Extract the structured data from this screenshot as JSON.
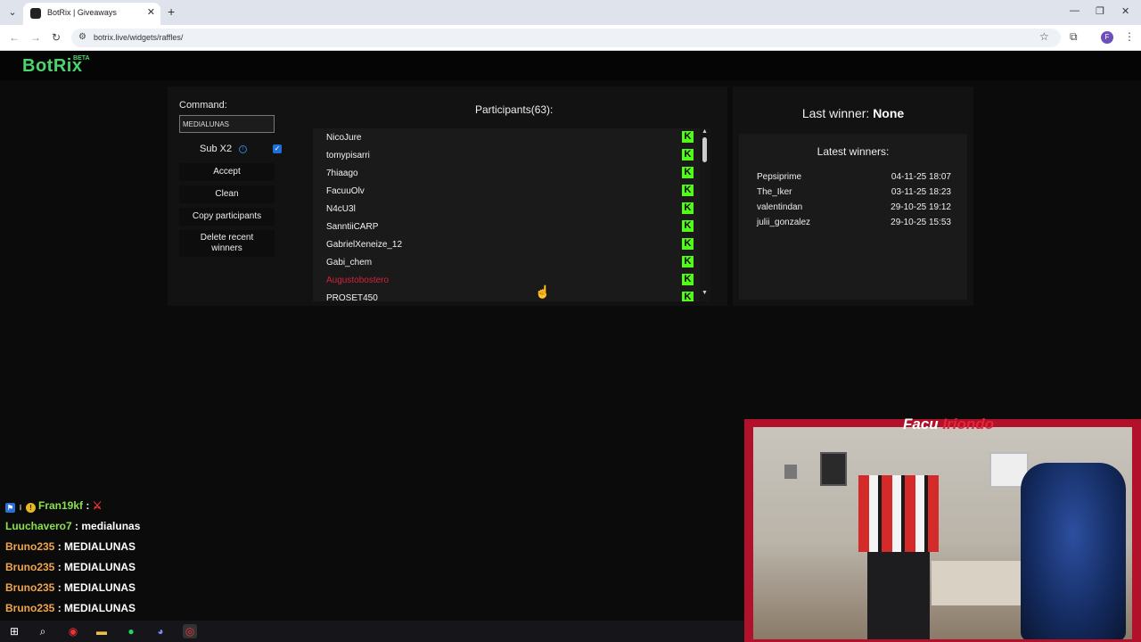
{
  "browser": {
    "tab_title": "BotRix | Giveaways",
    "url": "botrix.live/widgets/raffles/",
    "profile_initial": "F"
  },
  "header": {
    "logo": "BotRix",
    "logo_badge": "BETA"
  },
  "raffle": {
    "command_label": "Command:",
    "command_value": "MEDIALUNAS",
    "sub_label": "Sub X2",
    "sub_checked": true,
    "buttons": {
      "accept": "Accept",
      "clean": "Clean",
      "copy": "Copy participants",
      "delete": "Delete recent winners"
    },
    "participants_title": "Participants(63):",
    "participants": [
      {
        "name": "NicoJure",
        "color": "#f2f2f2"
      },
      {
        "name": "tomypisarri",
        "color": "#f2f2f2"
      },
      {
        "name": "7hiaago",
        "color": "#f2f2f2"
      },
      {
        "name": "FacuuOlv",
        "color": "#f2f2f2"
      },
      {
        "name": "N4cU3l",
        "color": "#f2f2f2"
      },
      {
        "name": "SanntiiCARP",
        "color": "#f2f2f2"
      },
      {
        "name": "GabrielXeneize_12",
        "color": "#f2f2f2"
      },
      {
        "name": "Gabi_chem",
        "color": "#f2f2f2"
      },
      {
        "name": "Augustobostero",
        "color": "#d1243a"
      },
      {
        "name": "PROSET450",
        "color": "#f2f2f2"
      }
    ],
    "platform_icon": "kick-icon"
  },
  "winners": {
    "last_winner_label": "Last winner:",
    "last_winner_value": "None",
    "latest_title": "Latest winners:",
    "list": [
      {
        "name": "Pepsiprime",
        "date": "04-11-25 18:07"
      },
      {
        "name": "The_Iker",
        "date": "03-11-25 18:23"
      },
      {
        "name": "valentindan",
        "date": "29-10-25 19:12"
      },
      {
        "name": "julii_gonzalez",
        "date": "29-10-25 15:53"
      }
    ]
  },
  "chat": [
    {
      "user": "Fran19kf",
      "msg": "",
      "user_color": "#8be04e"
    },
    {
      "user": "Luuchavero7",
      "msg": "medialunas",
      "user_color": "#8be04e"
    },
    {
      "user": "Bruno235",
      "msg": "MEDIALUNAS",
      "user_color": "#f0a54b"
    },
    {
      "user": "Bruno235",
      "msg": "MEDIALUNAS",
      "user_color": "#f0a54b"
    },
    {
      "user": "Bruno235",
      "msg": "MEDIALUNAS",
      "user_color": "#f0a54b"
    },
    {
      "user": "Bruno235",
      "msg": "MEDIALUNAS",
      "user_color": "#f0a54b"
    }
  ],
  "camera": {
    "name_first": "Facu",
    "name_last": "Iriondo"
  },
  "colors": {
    "accent_green": "#4ad66d",
    "kick_green": "#53fc18",
    "camera_red": "#b1112a"
  }
}
